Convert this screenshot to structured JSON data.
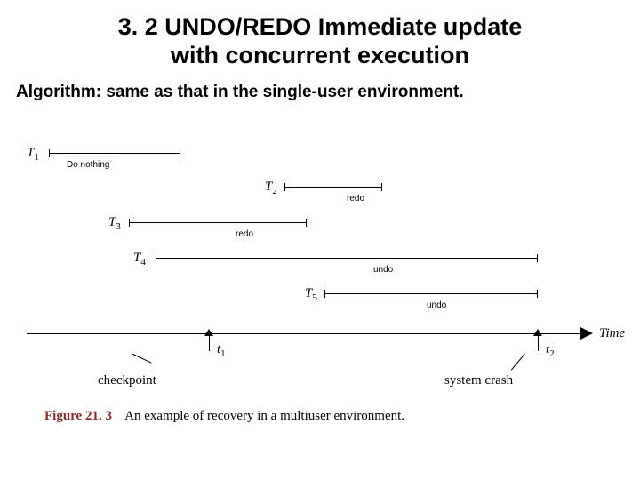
{
  "title": {
    "line1": "3. 2 UNDO/REDO Immediate update",
    "line2": "with concurrent execution"
  },
  "subtitle": "Algorithm: same as that in the single-user environment.",
  "transactions": {
    "t1": {
      "label_letter": "T",
      "label_sub": "1",
      "action": "Do nothing"
    },
    "t2": {
      "label_letter": "T",
      "label_sub": "2",
      "action": "redo"
    },
    "t3": {
      "label_letter": "T",
      "label_sub": "3",
      "action": "redo"
    },
    "t4": {
      "label_letter": "T",
      "label_sub": "4",
      "action": "undo"
    },
    "t5": {
      "label_letter": "T",
      "label_sub": "5",
      "action": "undo"
    }
  },
  "axis": {
    "t1_letter": "t",
    "t1_sub": "1",
    "t2_letter": "t",
    "t2_sub": "2",
    "time_label": "Time",
    "checkpoint": "checkpoint",
    "crash": "system crash"
  },
  "caption": {
    "fig": "Figure 21. 3",
    "text": "An example of recovery in a multiuser environment."
  }
}
